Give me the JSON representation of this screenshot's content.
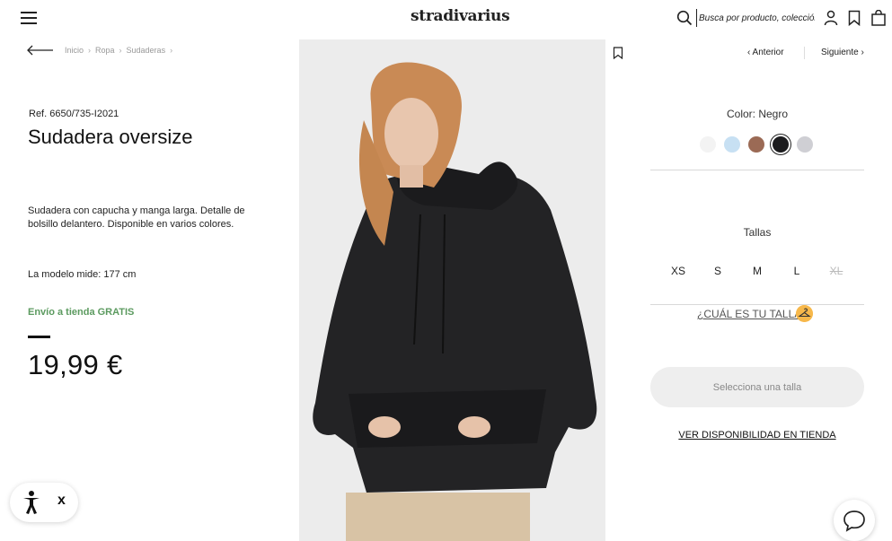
{
  "header": {
    "logo": "stradivarius",
    "search_placeholder": "Busca por producto, colección..."
  },
  "breadcrumb": [
    "Inicio",
    "Ropa",
    "Sudaderas"
  ],
  "breadcrumb_sep": "›",
  "product": {
    "ref": "Ref. 6650/735-I2021",
    "title": "Sudadera oversize",
    "description": "Sudadera con capucha y manga larga. Detalle de bolsillo delantero. Disponible en varios colores.",
    "model_height": "La modelo mide: 177 cm",
    "shipping": "Envío a tienda GRATIS",
    "price": "19,99 €"
  },
  "nav": {
    "prev": "‹ Anterior",
    "next": "Siguiente ›"
  },
  "colors": {
    "label": "Color: Negro",
    "swatches": [
      {
        "name": "white",
        "hex": "#f3f3f3",
        "selected": false
      },
      {
        "name": "light-blue",
        "hex": "#c7e0f3",
        "selected": false
      },
      {
        "name": "brown",
        "hex": "#9b6a55",
        "selected": false
      },
      {
        "name": "black",
        "hex": "#1c1c1e",
        "selected": true
      },
      {
        "name": "grey",
        "hex": "#cfcfd4",
        "selected": false
      }
    ]
  },
  "sizes": {
    "label": "Tallas",
    "items": [
      {
        "label": "XS",
        "available": true
      },
      {
        "label": "S",
        "available": true
      },
      {
        "label": "M",
        "available": true
      },
      {
        "label": "L",
        "available": true
      },
      {
        "label": "XL",
        "available": false
      }
    ],
    "guide": "¿CUÁL ES TU TALLA?"
  },
  "cta": {
    "label": "Selecciona una talla"
  },
  "store_availability": "VER DISPONIBILIDAD EN TIENDA",
  "accessibility": {
    "close": "x"
  },
  "icons": {
    "menu": "hamburger-icon",
    "search": "search-icon",
    "account": "user-icon",
    "wishlist": "bookmark-icon",
    "cart": "shopping-bag-icon",
    "back": "arrow-left-icon",
    "accessibility": "accessibility-icon",
    "chat": "chat-icon",
    "size_guide": "hanger-icon"
  },
  "colors_theme": {
    "accent_green": "#5b9a5f",
    "badge_orange": "#f7b84b"
  }
}
